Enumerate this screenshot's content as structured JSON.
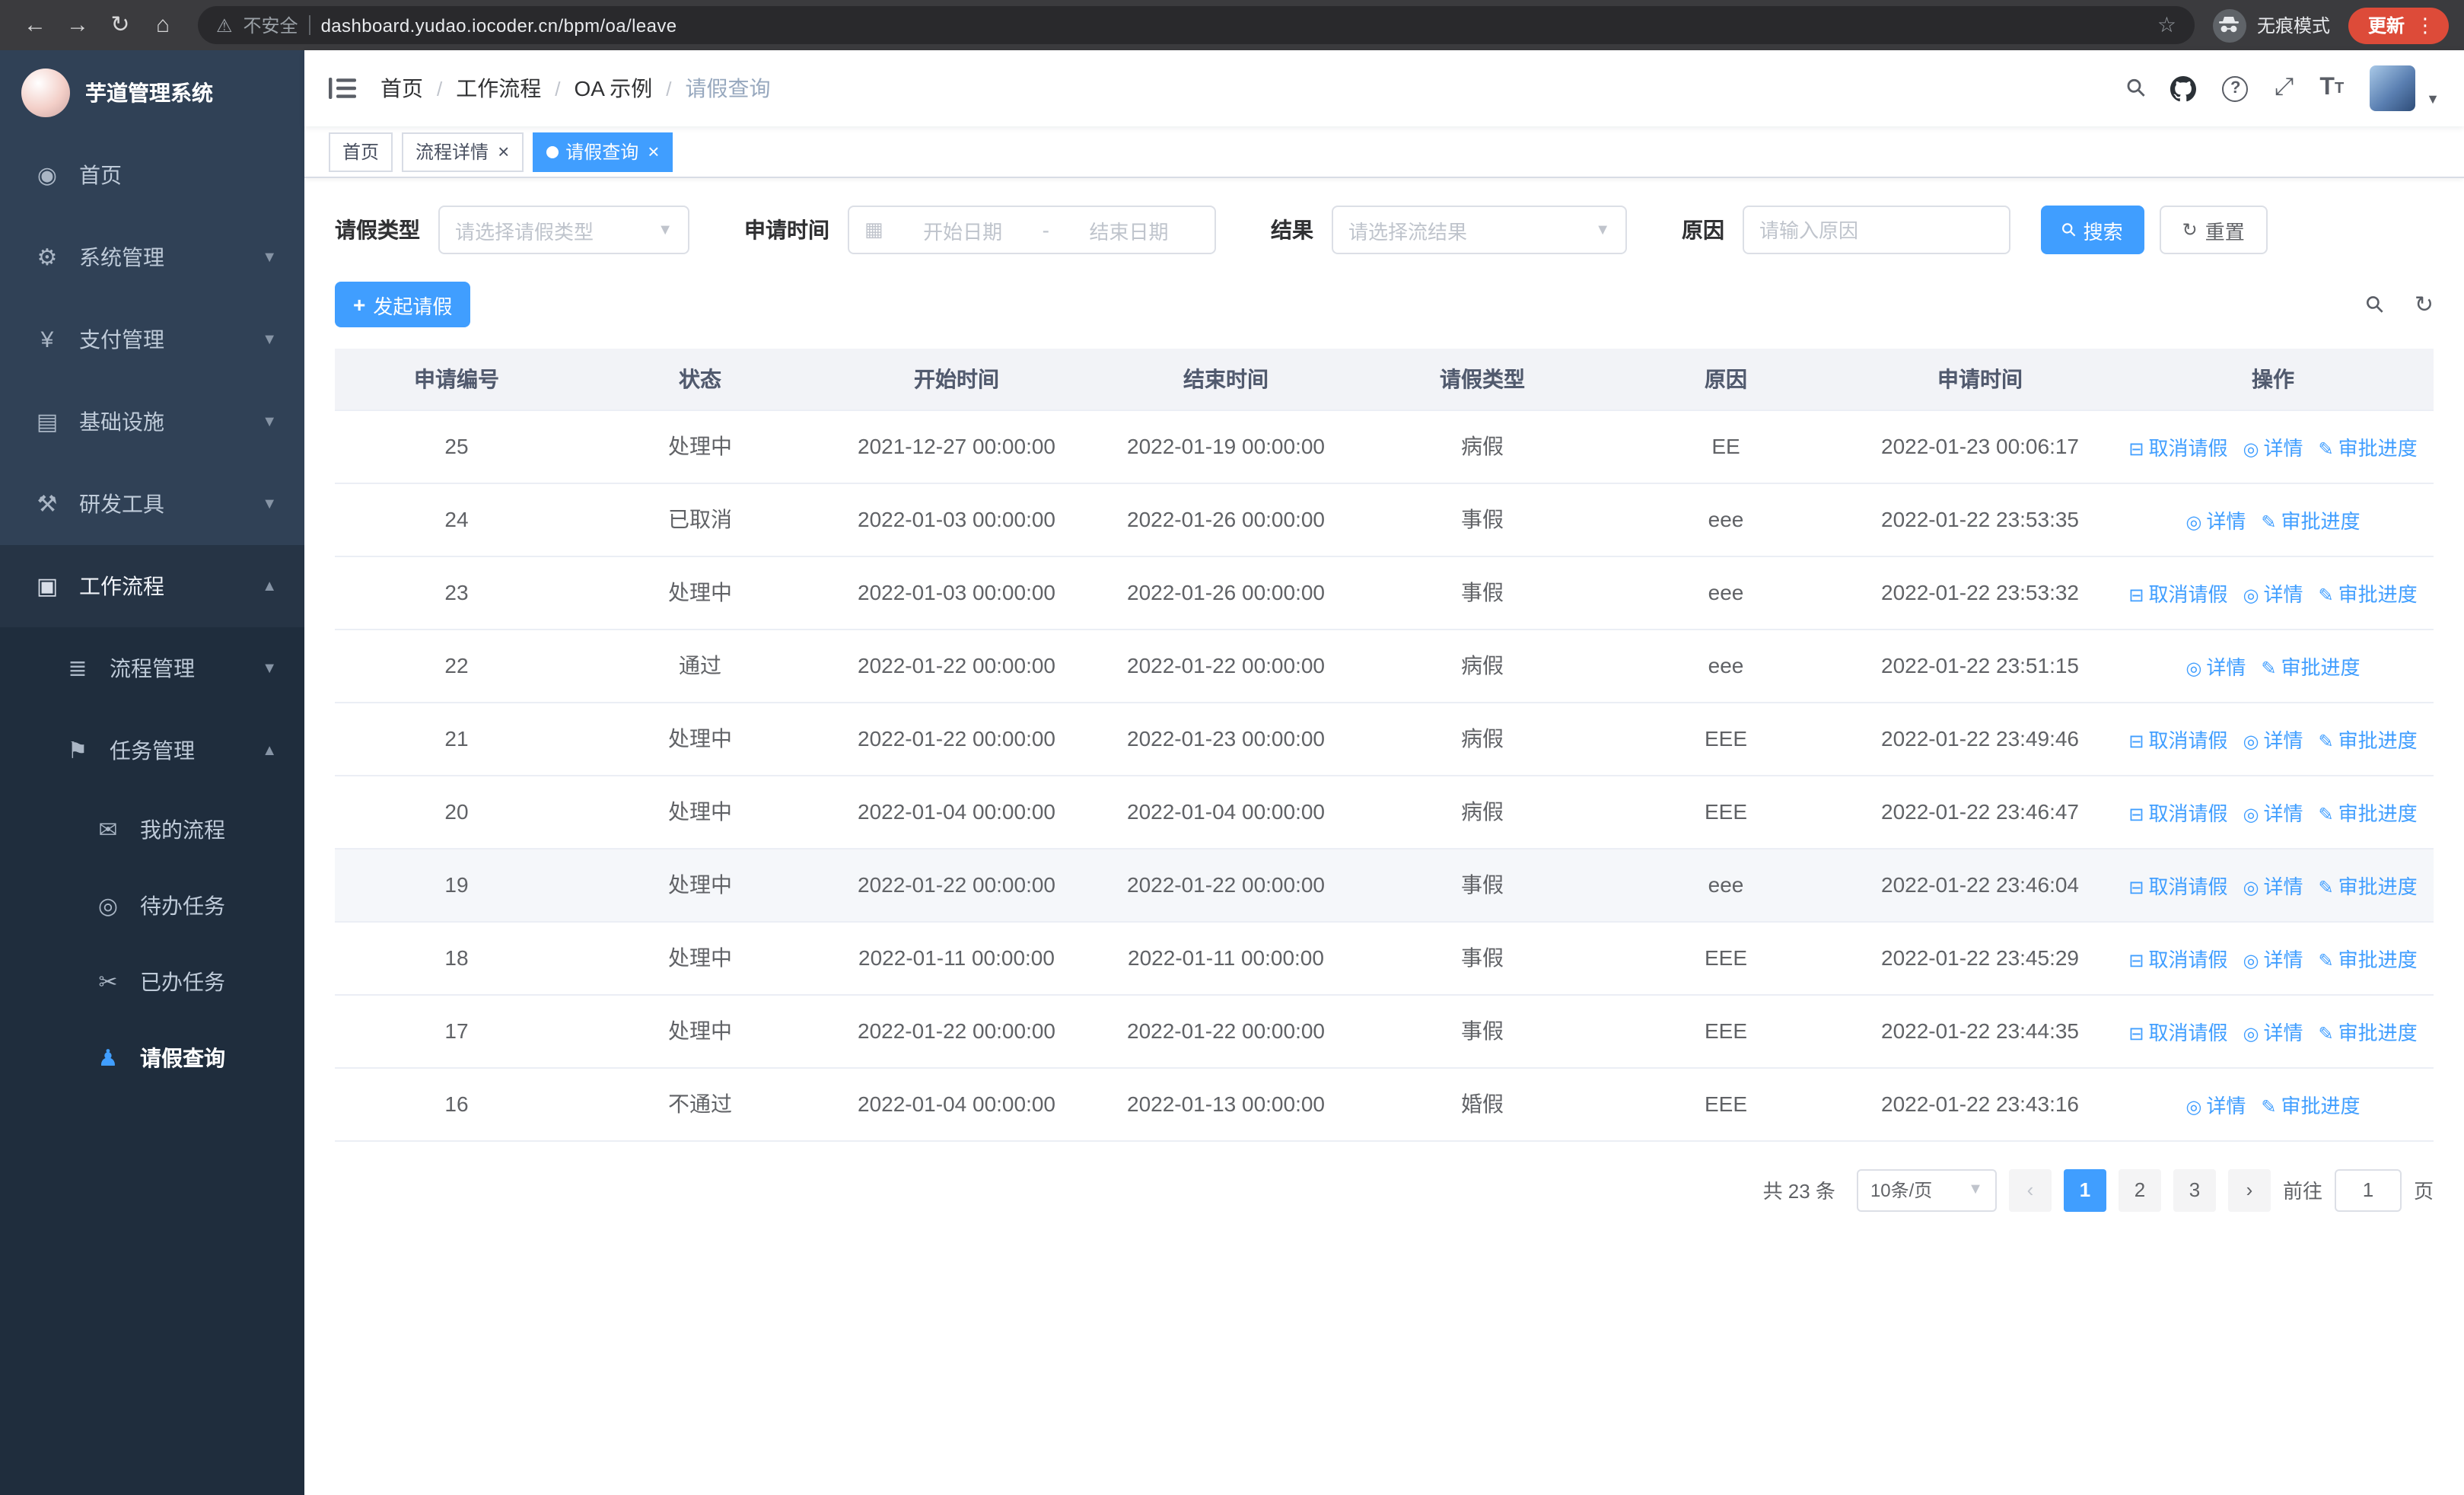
{
  "browser": {
    "security_label": "不安全",
    "url": "dashboard.yudao.iocoder.cn/bpm/oa/leave",
    "incognito_label": "无痕模式",
    "update_label": "更新"
  },
  "sidebar": {
    "logo_title": "芋道管理系统",
    "items": [
      {
        "label": "首页",
        "icon": "dashboard-icon",
        "level": 1,
        "chevron": "",
        "active": false,
        "open": false
      },
      {
        "label": "系统管理",
        "icon": "gear-icon",
        "level": 1,
        "chevron": "down",
        "active": false,
        "open": false
      },
      {
        "label": "支付管理",
        "icon": "yen-icon",
        "level": 1,
        "chevron": "down",
        "active": false,
        "open": false
      },
      {
        "label": "基础设施",
        "icon": "infra-icon",
        "level": 1,
        "chevron": "down",
        "active": false,
        "open": false
      },
      {
        "label": "研发工具",
        "icon": "tool-icon",
        "level": 1,
        "chevron": "down",
        "active": false,
        "open": false
      },
      {
        "label": "工作流程",
        "icon": "workflow-icon",
        "level": 1,
        "chevron": "up",
        "active": false,
        "open": true
      },
      {
        "label": "流程管理",
        "icon": "process-icon",
        "level": 2,
        "chevron": "down",
        "active": false,
        "open": false
      },
      {
        "label": "任务管理",
        "icon": "task-icon",
        "level": 2,
        "chevron": "up",
        "active": false,
        "open": true
      },
      {
        "label": "我的流程",
        "icon": "chat-icon",
        "level": 3,
        "chevron": "",
        "active": false,
        "open": false
      },
      {
        "label": "待办任务",
        "icon": "eye-icon",
        "level": 3,
        "chevron": "",
        "active": false,
        "open": false
      },
      {
        "label": "已办任务",
        "icon": "done-icon",
        "level": 3,
        "chevron": "",
        "active": false,
        "open": false
      },
      {
        "label": "请假查询",
        "icon": "user-icon",
        "level": 3,
        "chevron": "",
        "active": true,
        "open": false
      }
    ]
  },
  "header": {
    "breadcrumb": [
      "首页",
      "工作流程",
      "OA 示例",
      "请假查询"
    ],
    "separator": "/"
  },
  "tabs": [
    {
      "label": "首页",
      "closable": false,
      "active": false
    },
    {
      "label": "流程详情",
      "closable": true,
      "active": false
    },
    {
      "label": "请假查询",
      "closable": true,
      "active": true
    }
  ],
  "filters": {
    "leave_type_label": "请假类型",
    "leave_type_placeholder": "请选择请假类型",
    "apply_time_label": "申请时间",
    "start_date_placeholder": "开始日期",
    "range_separator": "-",
    "end_date_placeholder": "结束日期",
    "result_label": "结果",
    "result_placeholder": "请选择流结果",
    "reason_label": "原因",
    "reason_placeholder": "请输入原因",
    "search_label": "搜索",
    "reset_label": "重置"
  },
  "toolbar": {
    "create_label": "发起请假"
  },
  "table": {
    "columns": [
      "申请编号",
      "状态",
      "开始时间",
      "结束时间",
      "请假类型",
      "原因",
      "申请时间",
      "操作"
    ],
    "action_labels": {
      "cancel": "取消请假",
      "detail": "详情",
      "progress": "审批进度"
    },
    "rows": [
      {
        "id": "25",
        "status": "处理中",
        "start_time": "2021-12-27 00:00:00",
        "end_time": "2022-01-19 00:00:00",
        "leave_type": "病假",
        "reason": "EE",
        "apply_time": "2022-01-23 00:06:17",
        "can_cancel": true,
        "highlighted": false
      },
      {
        "id": "24",
        "status": "已取消",
        "start_time": "2022-01-03 00:00:00",
        "end_time": "2022-01-26 00:00:00",
        "leave_type": "事假",
        "reason": "eee",
        "apply_time": "2022-01-22 23:53:35",
        "can_cancel": false,
        "highlighted": false
      },
      {
        "id": "23",
        "status": "处理中",
        "start_time": "2022-01-03 00:00:00",
        "end_time": "2022-01-26 00:00:00",
        "leave_type": "事假",
        "reason": "eee",
        "apply_time": "2022-01-22 23:53:32",
        "can_cancel": true,
        "highlighted": false
      },
      {
        "id": "22",
        "status": "通过",
        "start_time": "2022-01-22 00:00:00",
        "end_time": "2022-01-22 00:00:00",
        "leave_type": "病假",
        "reason": "eee",
        "apply_time": "2022-01-22 23:51:15",
        "can_cancel": false,
        "highlighted": false
      },
      {
        "id": "21",
        "status": "处理中",
        "start_time": "2022-01-22 00:00:00",
        "end_time": "2022-01-23 00:00:00",
        "leave_type": "病假",
        "reason": "EEE",
        "apply_time": "2022-01-22 23:49:46",
        "can_cancel": true,
        "highlighted": false
      },
      {
        "id": "20",
        "status": "处理中",
        "start_time": "2022-01-04 00:00:00",
        "end_time": "2022-01-04 00:00:00",
        "leave_type": "病假",
        "reason": "EEE",
        "apply_time": "2022-01-22 23:46:47",
        "can_cancel": true,
        "highlighted": false
      },
      {
        "id": "19",
        "status": "处理中",
        "start_time": "2022-01-22 00:00:00",
        "end_time": "2022-01-22 00:00:00",
        "leave_type": "事假",
        "reason": "eee",
        "apply_time": "2022-01-22 23:46:04",
        "can_cancel": true,
        "highlighted": true
      },
      {
        "id": "18",
        "status": "处理中",
        "start_time": "2022-01-11 00:00:00",
        "end_time": "2022-01-11 00:00:00",
        "leave_type": "事假",
        "reason": "EEE",
        "apply_time": "2022-01-22 23:45:29",
        "can_cancel": true,
        "highlighted": false
      },
      {
        "id": "17",
        "status": "处理中",
        "start_time": "2022-01-22 00:00:00",
        "end_time": "2022-01-22 00:00:00",
        "leave_type": "事假",
        "reason": "EEE",
        "apply_time": "2022-01-22 23:44:35",
        "can_cancel": true,
        "highlighted": false
      },
      {
        "id": "16",
        "status": "不通过",
        "start_time": "2022-01-04 00:00:00",
        "end_time": "2022-01-13 00:00:00",
        "leave_type": "婚假",
        "reason": "EEE",
        "apply_time": "2022-01-22 23:43:16",
        "can_cancel": false,
        "highlighted": false
      }
    ]
  },
  "pagination": {
    "total_text": "共 23 条",
    "page_size": "10条/页",
    "prev_icon": "‹",
    "next_icon": "›",
    "pages": [
      "1",
      "2",
      "3"
    ],
    "active": "1",
    "goto_label": "前往",
    "goto_value": "1",
    "unit": "页"
  }
}
